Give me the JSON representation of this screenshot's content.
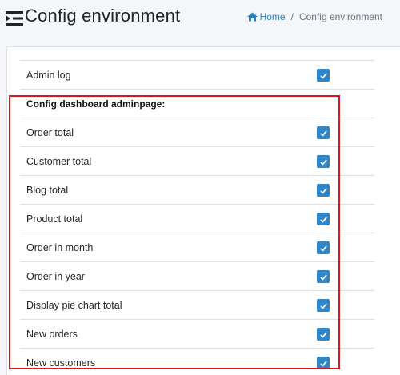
{
  "header": {
    "title": "Config environment",
    "menu_icon": "menu-collapse-icon"
  },
  "breadcrumb": {
    "home": "Home",
    "separator": "/",
    "current": "Config environment"
  },
  "settings": {
    "admin_log": {
      "label": "Admin log",
      "checked": true
    },
    "section_title": "Config dashboard adminpage:",
    "items": [
      {
        "label": "Order total",
        "checked": true
      },
      {
        "label": "Customer total",
        "checked": true
      },
      {
        "label": "Blog total",
        "checked": true
      },
      {
        "label": "Product total",
        "checked": true
      },
      {
        "label": "Order in month",
        "checked": true
      },
      {
        "label": "Order in year",
        "checked": true
      },
      {
        "label": "Display pie chart total",
        "checked": true
      },
      {
        "label": "New orders",
        "checked": true
      },
      {
        "label": "New customers",
        "checked": true
      }
    ]
  },
  "colors": {
    "accent": "#2e86c9",
    "link": "#2980b9",
    "highlight": "#e0141b",
    "background": "#f4f6f9"
  }
}
